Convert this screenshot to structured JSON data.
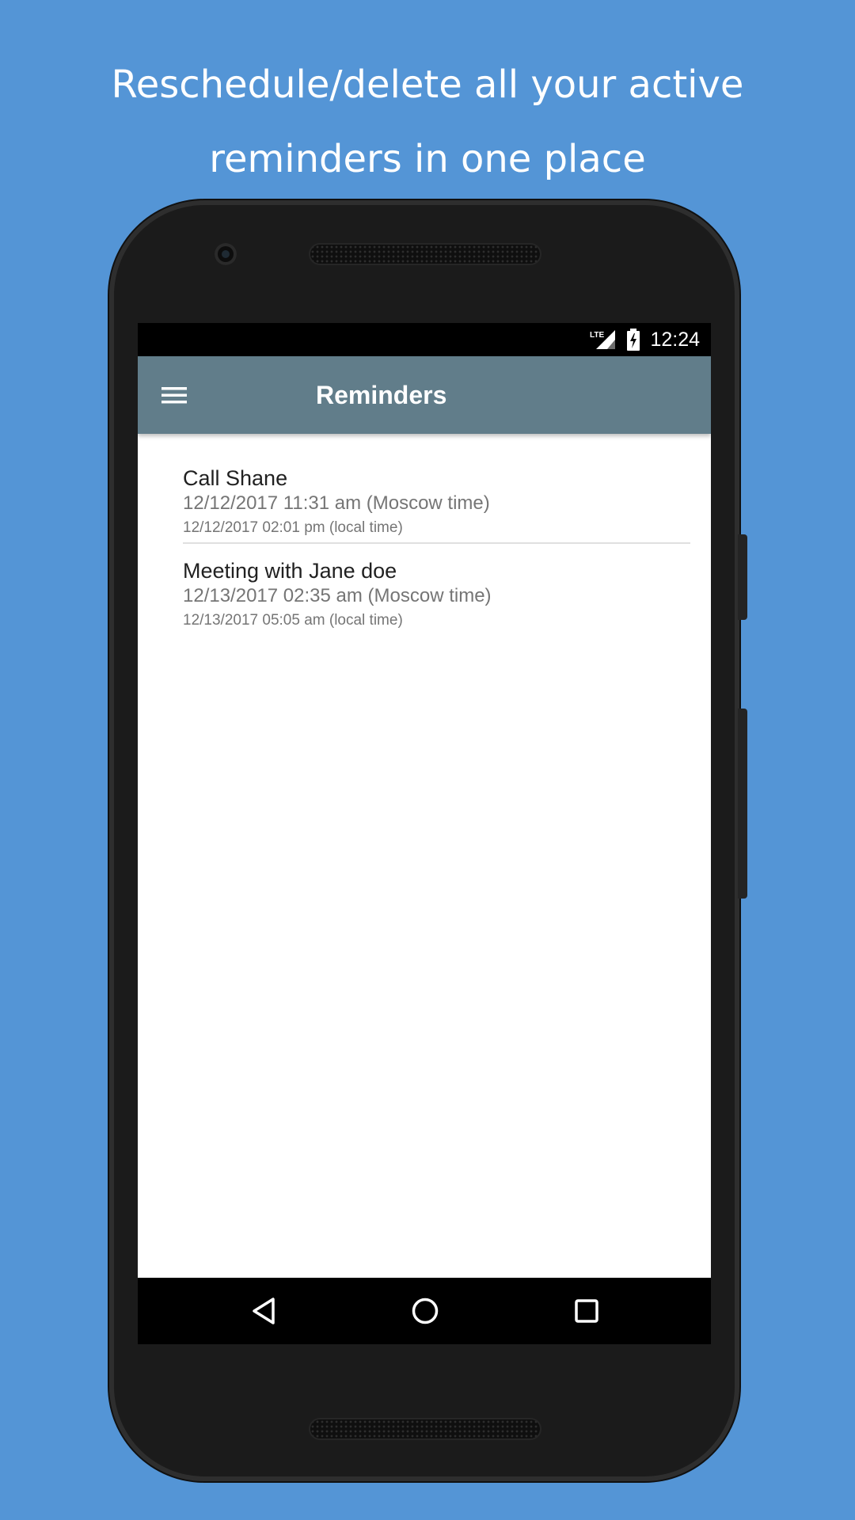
{
  "promo": {
    "line1": "Reschedule/delete all your active",
    "line2": "reminders in one place"
  },
  "status_bar": {
    "network_icon": "lte-signal-icon",
    "battery_icon": "battery-charging-icon",
    "time": "12:24"
  },
  "app_bar": {
    "menu_icon": "hamburger-menu-icon",
    "title": "Reminders",
    "background_color": "#617d8a"
  },
  "reminders": [
    {
      "title": "Call Shane",
      "moscow_time": "12/12/2017 11:31 am (Moscow time)",
      "local_time": "12/12/2017 02:01 pm (local time)"
    },
    {
      "title": "Meeting with Jane doe",
      "moscow_time": "12/13/2017 02:35 am (Moscow time)",
      "local_time": "12/13/2017 05:05 am (local time)"
    }
  ],
  "nav_bar": {
    "back_icon": "back-triangle-icon",
    "home_icon": "home-circle-icon",
    "recents_icon": "recents-square-icon"
  },
  "colors": {
    "page_background": "#5495d6",
    "phone_body": "#1b1b1b"
  }
}
